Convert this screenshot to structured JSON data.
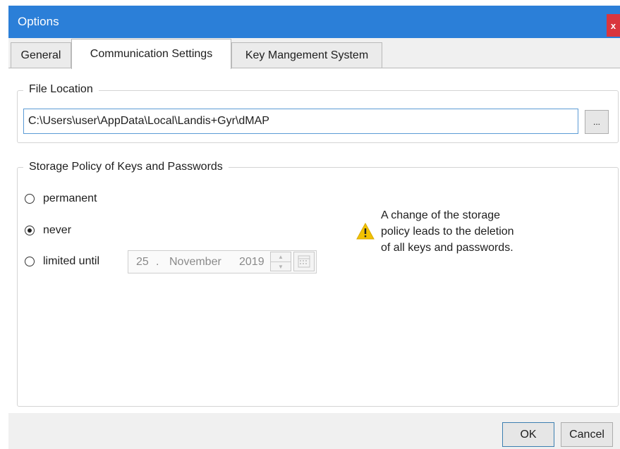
{
  "window": {
    "title": "Options",
    "close_label": "x"
  },
  "tabs": [
    {
      "label": "General",
      "active": false
    },
    {
      "label": "Communication Settings",
      "active": true
    },
    {
      "label": "Key Mangement System",
      "active": false
    }
  ],
  "file_location": {
    "legend": "File Location",
    "path_value": "C:\\Users\\user\\AppData\\Local\\Landis+Gyr\\dMAP",
    "browse_label": "..."
  },
  "storage_policy": {
    "legend": "Storage Policy of Keys and Passwords",
    "options": [
      {
        "label": "permanent",
        "checked": false
      },
      {
        "label": "never",
        "checked": true
      },
      {
        "label": "limited until",
        "checked": false
      }
    ],
    "date": {
      "day": "25",
      "separator": ".",
      "month": "November",
      "year": "2019"
    },
    "warning_lines": [
      "A change of the storage",
      "policy leads to the deletion",
      "of all keys and passwords."
    ],
    "warning_icon": "warning-icon"
  },
  "footer": {
    "ok_label": "OK",
    "cancel_label": "Cancel"
  },
  "colors": {
    "title_bar": "#2b7fd8",
    "close_button": "#d9363e",
    "input_border": "#5b9bd5",
    "warning": "#f2c200"
  }
}
